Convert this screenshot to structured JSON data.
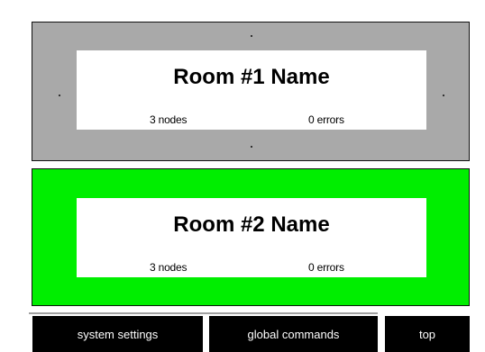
{
  "rooms": [
    {
      "name": "Room #1 Name",
      "nodes": "3 nodes",
      "errors": "0 errors",
      "color": "#a9a9a9",
      "state": "selected"
    },
    {
      "name": "Room #2 Name",
      "nodes": "3 nodes",
      "errors": "0 errors",
      "color": "#00ee00",
      "state": "ok"
    }
  ],
  "footer": {
    "system_settings_label": "system settings",
    "global_commands_label": "global commands",
    "top_label": "top"
  }
}
